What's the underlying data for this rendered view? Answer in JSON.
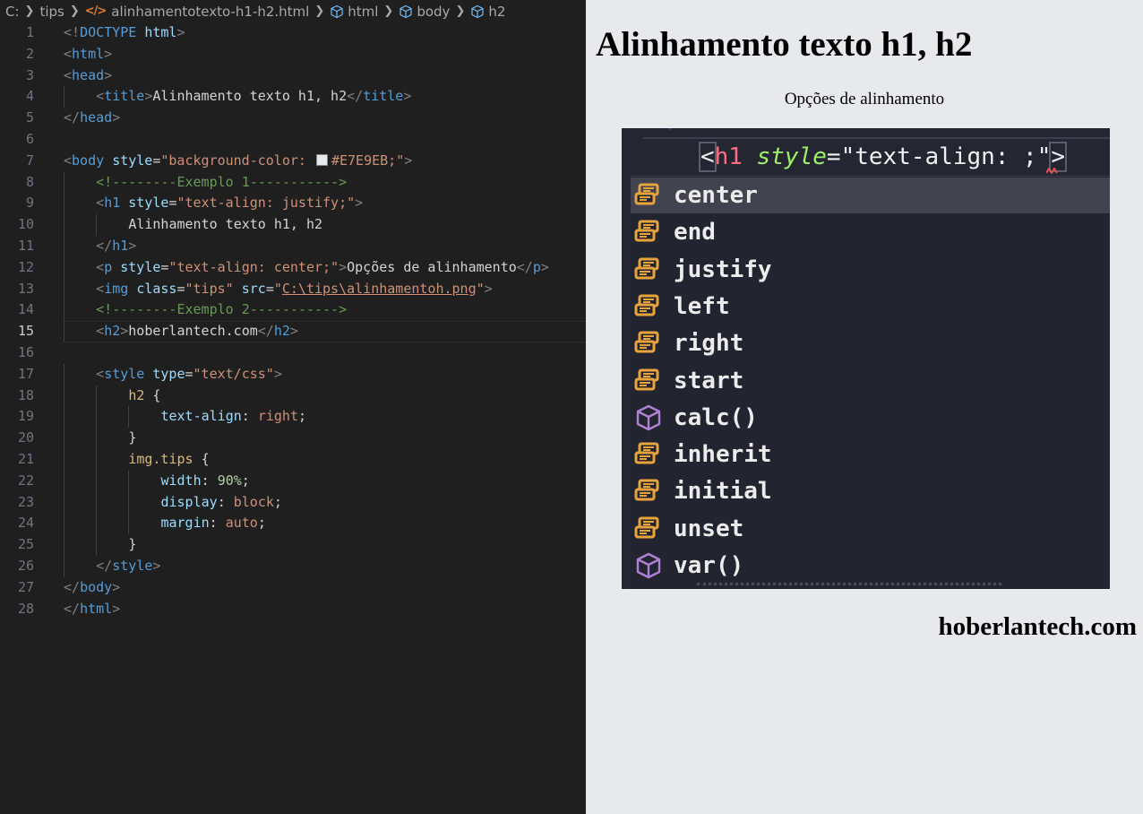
{
  "breadcrumb": {
    "items": [
      "C:",
      "tips",
      "alinhamentotexto-h1-h2.html",
      "html",
      "body",
      "h2"
    ]
  },
  "editor": {
    "active_line": 15,
    "lines": [
      {
        "n": 1,
        "indent": 0,
        "tokens": [
          [
            "punct",
            "<!"
          ],
          [
            "tag",
            "DOCTYPE"
          ],
          [
            "text",
            " "
          ],
          [
            "attr",
            "html"
          ],
          [
            "punct",
            ">"
          ]
        ]
      },
      {
        "n": 2,
        "indent": 0,
        "tokens": [
          [
            "punct",
            "<"
          ],
          [
            "tag",
            "html"
          ],
          [
            "punct",
            ">"
          ]
        ]
      },
      {
        "n": 3,
        "indent": 0,
        "tokens": [
          [
            "punct",
            "<"
          ],
          [
            "tag",
            "head"
          ],
          [
            "punct",
            ">"
          ]
        ]
      },
      {
        "n": 4,
        "indent": 1,
        "tokens": [
          [
            "punct",
            "<"
          ],
          [
            "tag",
            "title"
          ],
          [
            "punct",
            ">"
          ],
          [
            "text",
            "Alinhamento texto h1, h2"
          ],
          [
            "punct",
            "</"
          ],
          [
            "tag",
            "title"
          ],
          [
            "punct",
            ">"
          ]
        ]
      },
      {
        "n": 5,
        "indent": 0,
        "tokens": [
          [
            "punct",
            "</"
          ],
          [
            "tag",
            "head"
          ],
          [
            "punct",
            ">"
          ]
        ]
      },
      {
        "n": 6,
        "indent": 0,
        "tokens": []
      },
      {
        "n": 7,
        "indent": 0,
        "tokens": [
          [
            "punct",
            "<"
          ],
          [
            "tag",
            "body"
          ],
          [
            "text",
            " "
          ],
          [
            "attr",
            "style"
          ],
          [
            "text",
            "="
          ],
          [
            "str",
            "\"background-color: "
          ],
          [
            "swatch",
            ""
          ],
          [
            "str",
            "#E7E9EB;\""
          ],
          [
            "punct",
            ">"
          ]
        ]
      },
      {
        "n": 8,
        "indent": 1,
        "tokens": [
          [
            "comment",
            "<!--------Exemplo 1----------->"
          ]
        ]
      },
      {
        "n": 9,
        "indent": 1,
        "tokens": [
          [
            "punct",
            "<"
          ],
          [
            "tag",
            "h1"
          ],
          [
            "text",
            " "
          ],
          [
            "attr",
            "style"
          ],
          [
            "text",
            "="
          ],
          [
            "str",
            "\"text-align: justify;\""
          ],
          [
            "punct",
            ">"
          ]
        ]
      },
      {
        "n": 10,
        "indent": 2,
        "tokens": [
          [
            "text",
            "Alinhamento texto h1, h2"
          ]
        ]
      },
      {
        "n": 11,
        "indent": 1,
        "tokens": [
          [
            "punct",
            "</"
          ],
          [
            "tag",
            "h1"
          ],
          [
            "punct",
            ">"
          ]
        ]
      },
      {
        "n": 12,
        "indent": 1,
        "tokens": [
          [
            "punct",
            "<"
          ],
          [
            "tag",
            "p"
          ],
          [
            "text",
            " "
          ],
          [
            "attr",
            "style"
          ],
          [
            "text",
            "="
          ],
          [
            "str",
            "\"text-align: center;\""
          ],
          [
            "punct",
            ">"
          ],
          [
            "text",
            "Opções de alinhamento"
          ],
          [
            "punct",
            "</"
          ],
          [
            "tag",
            "p"
          ],
          [
            "punct",
            ">"
          ]
        ]
      },
      {
        "n": 13,
        "indent": 1,
        "tokens": [
          [
            "punct",
            "<"
          ],
          [
            "tag",
            "img"
          ],
          [
            "text",
            " "
          ],
          [
            "attr",
            "class"
          ],
          [
            "text",
            "="
          ],
          [
            "str",
            "\"tips\""
          ],
          [
            "text",
            " "
          ],
          [
            "attr",
            "src"
          ],
          [
            "text",
            "="
          ],
          [
            "str",
            "\""
          ],
          [
            "link",
            "C:\\tips\\alinhamentoh.png"
          ],
          [
            "str",
            "\""
          ],
          [
            "punct",
            ">"
          ]
        ]
      },
      {
        "n": 14,
        "indent": 1,
        "tokens": [
          [
            "comment",
            "<!--------Exemplo 2----------->"
          ]
        ]
      },
      {
        "n": 15,
        "indent": 1,
        "tokens": [
          [
            "punct",
            "<"
          ],
          [
            "tag",
            "h2"
          ],
          [
            "punct",
            ">"
          ],
          [
            "text",
            "hoberlantech.com"
          ],
          [
            "punct",
            "</"
          ],
          [
            "tag",
            "h2"
          ],
          [
            "punct",
            ">"
          ]
        ]
      },
      {
        "n": 16,
        "indent": 0,
        "tokens": []
      },
      {
        "n": 17,
        "indent": 1,
        "tokens": [
          [
            "punct",
            "<"
          ],
          [
            "tag",
            "style"
          ],
          [
            "text",
            " "
          ],
          [
            "attr",
            "type"
          ],
          [
            "text",
            "="
          ],
          [
            "str",
            "\"text/css\""
          ],
          [
            "punct",
            ">"
          ]
        ]
      },
      {
        "n": 18,
        "indent": 2,
        "tokens": [
          [
            "sel",
            "h2"
          ],
          [
            "text",
            " {"
          ]
        ]
      },
      {
        "n": 19,
        "indent": 3,
        "tokens": [
          [
            "prop",
            "text-align"
          ],
          [
            "text",
            ": "
          ],
          [
            "str",
            "right"
          ],
          [
            "text",
            ";"
          ]
        ]
      },
      {
        "n": 20,
        "indent": 2,
        "tokens": [
          [
            "text",
            "}"
          ]
        ]
      },
      {
        "n": 21,
        "indent": 2,
        "tokens": [
          [
            "sel",
            "img.tips"
          ],
          [
            "text",
            " {"
          ]
        ]
      },
      {
        "n": 22,
        "indent": 3,
        "tokens": [
          [
            "prop",
            "width"
          ],
          [
            "text",
            ": "
          ],
          [
            "num",
            "90%"
          ],
          [
            "text",
            ";"
          ]
        ]
      },
      {
        "n": 23,
        "indent": 3,
        "tokens": [
          [
            "prop",
            "display"
          ],
          [
            "text",
            ": "
          ],
          [
            "str",
            "block"
          ],
          [
            "text",
            ";"
          ]
        ]
      },
      {
        "n": 24,
        "indent": 3,
        "tokens": [
          [
            "prop",
            "margin"
          ],
          [
            "text",
            ": "
          ],
          [
            "str",
            "auto"
          ],
          [
            "text",
            ";"
          ]
        ]
      },
      {
        "n": 25,
        "indent": 2,
        "tokens": [
          [
            "text",
            "}"
          ]
        ]
      },
      {
        "n": 26,
        "indent": 1,
        "tokens": [
          [
            "punct",
            "</"
          ],
          [
            "tag",
            "style"
          ],
          [
            "punct",
            ">"
          ]
        ]
      },
      {
        "n": 27,
        "indent": 0,
        "tokens": [
          [
            "punct",
            "</"
          ],
          [
            "tag",
            "body"
          ],
          [
            "punct",
            ">"
          ]
        ]
      },
      {
        "n": 28,
        "indent": 0,
        "tokens": [
          [
            "punct",
            "</"
          ],
          [
            "tag",
            "html"
          ],
          [
            "punct",
            ">"
          ]
        ]
      }
    ]
  },
  "preview": {
    "background": "#E7E9EB",
    "h1": "Alinhamento texto h1, h2",
    "p": "Opções de alinhamento",
    "h2": "hoberlantech.com",
    "image": {
      "code_line": {
        "open": "<",
        "tag": "h1",
        "attr": "style",
        "eq": "=",
        "value": "\"text-align: ;\"",
        "close": ">"
      },
      "suggestions": [
        {
          "label": "center",
          "kind": "value"
        },
        {
          "label": "end",
          "kind": "value"
        },
        {
          "label": "justify",
          "kind": "value"
        },
        {
          "label": "left",
          "kind": "value"
        },
        {
          "label": "right",
          "kind": "value"
        },
        {
          "label": "start",
          "kind": "value"
        },
        {
          "label": "calc()",
          "kind": "function"
        },
        {
          "label": "inherit",
          "kind": "value"
        },
        {
          "label": "initial",
          "kind": "value"
        },
        {
          "label": "unset",
          "kind": "value"
        },
        {
          "label": "var()",
          "kind": "function"
        }
      ],
      "selected_index": 0
    }
  },
  "colors": {
    "editor_bg": "#1f1f1f",
    "tag": "#569cd6",
    "attribute": "#9cdcfe",
    "string": "#ce9178",
    "comment": "#6a9955",
    "selector": "#d7ba7d",
    "number": "#b5cea8",
    "enum_icon": "#e8a33d",
    "function_icon": "#b180d7"
  }
}
